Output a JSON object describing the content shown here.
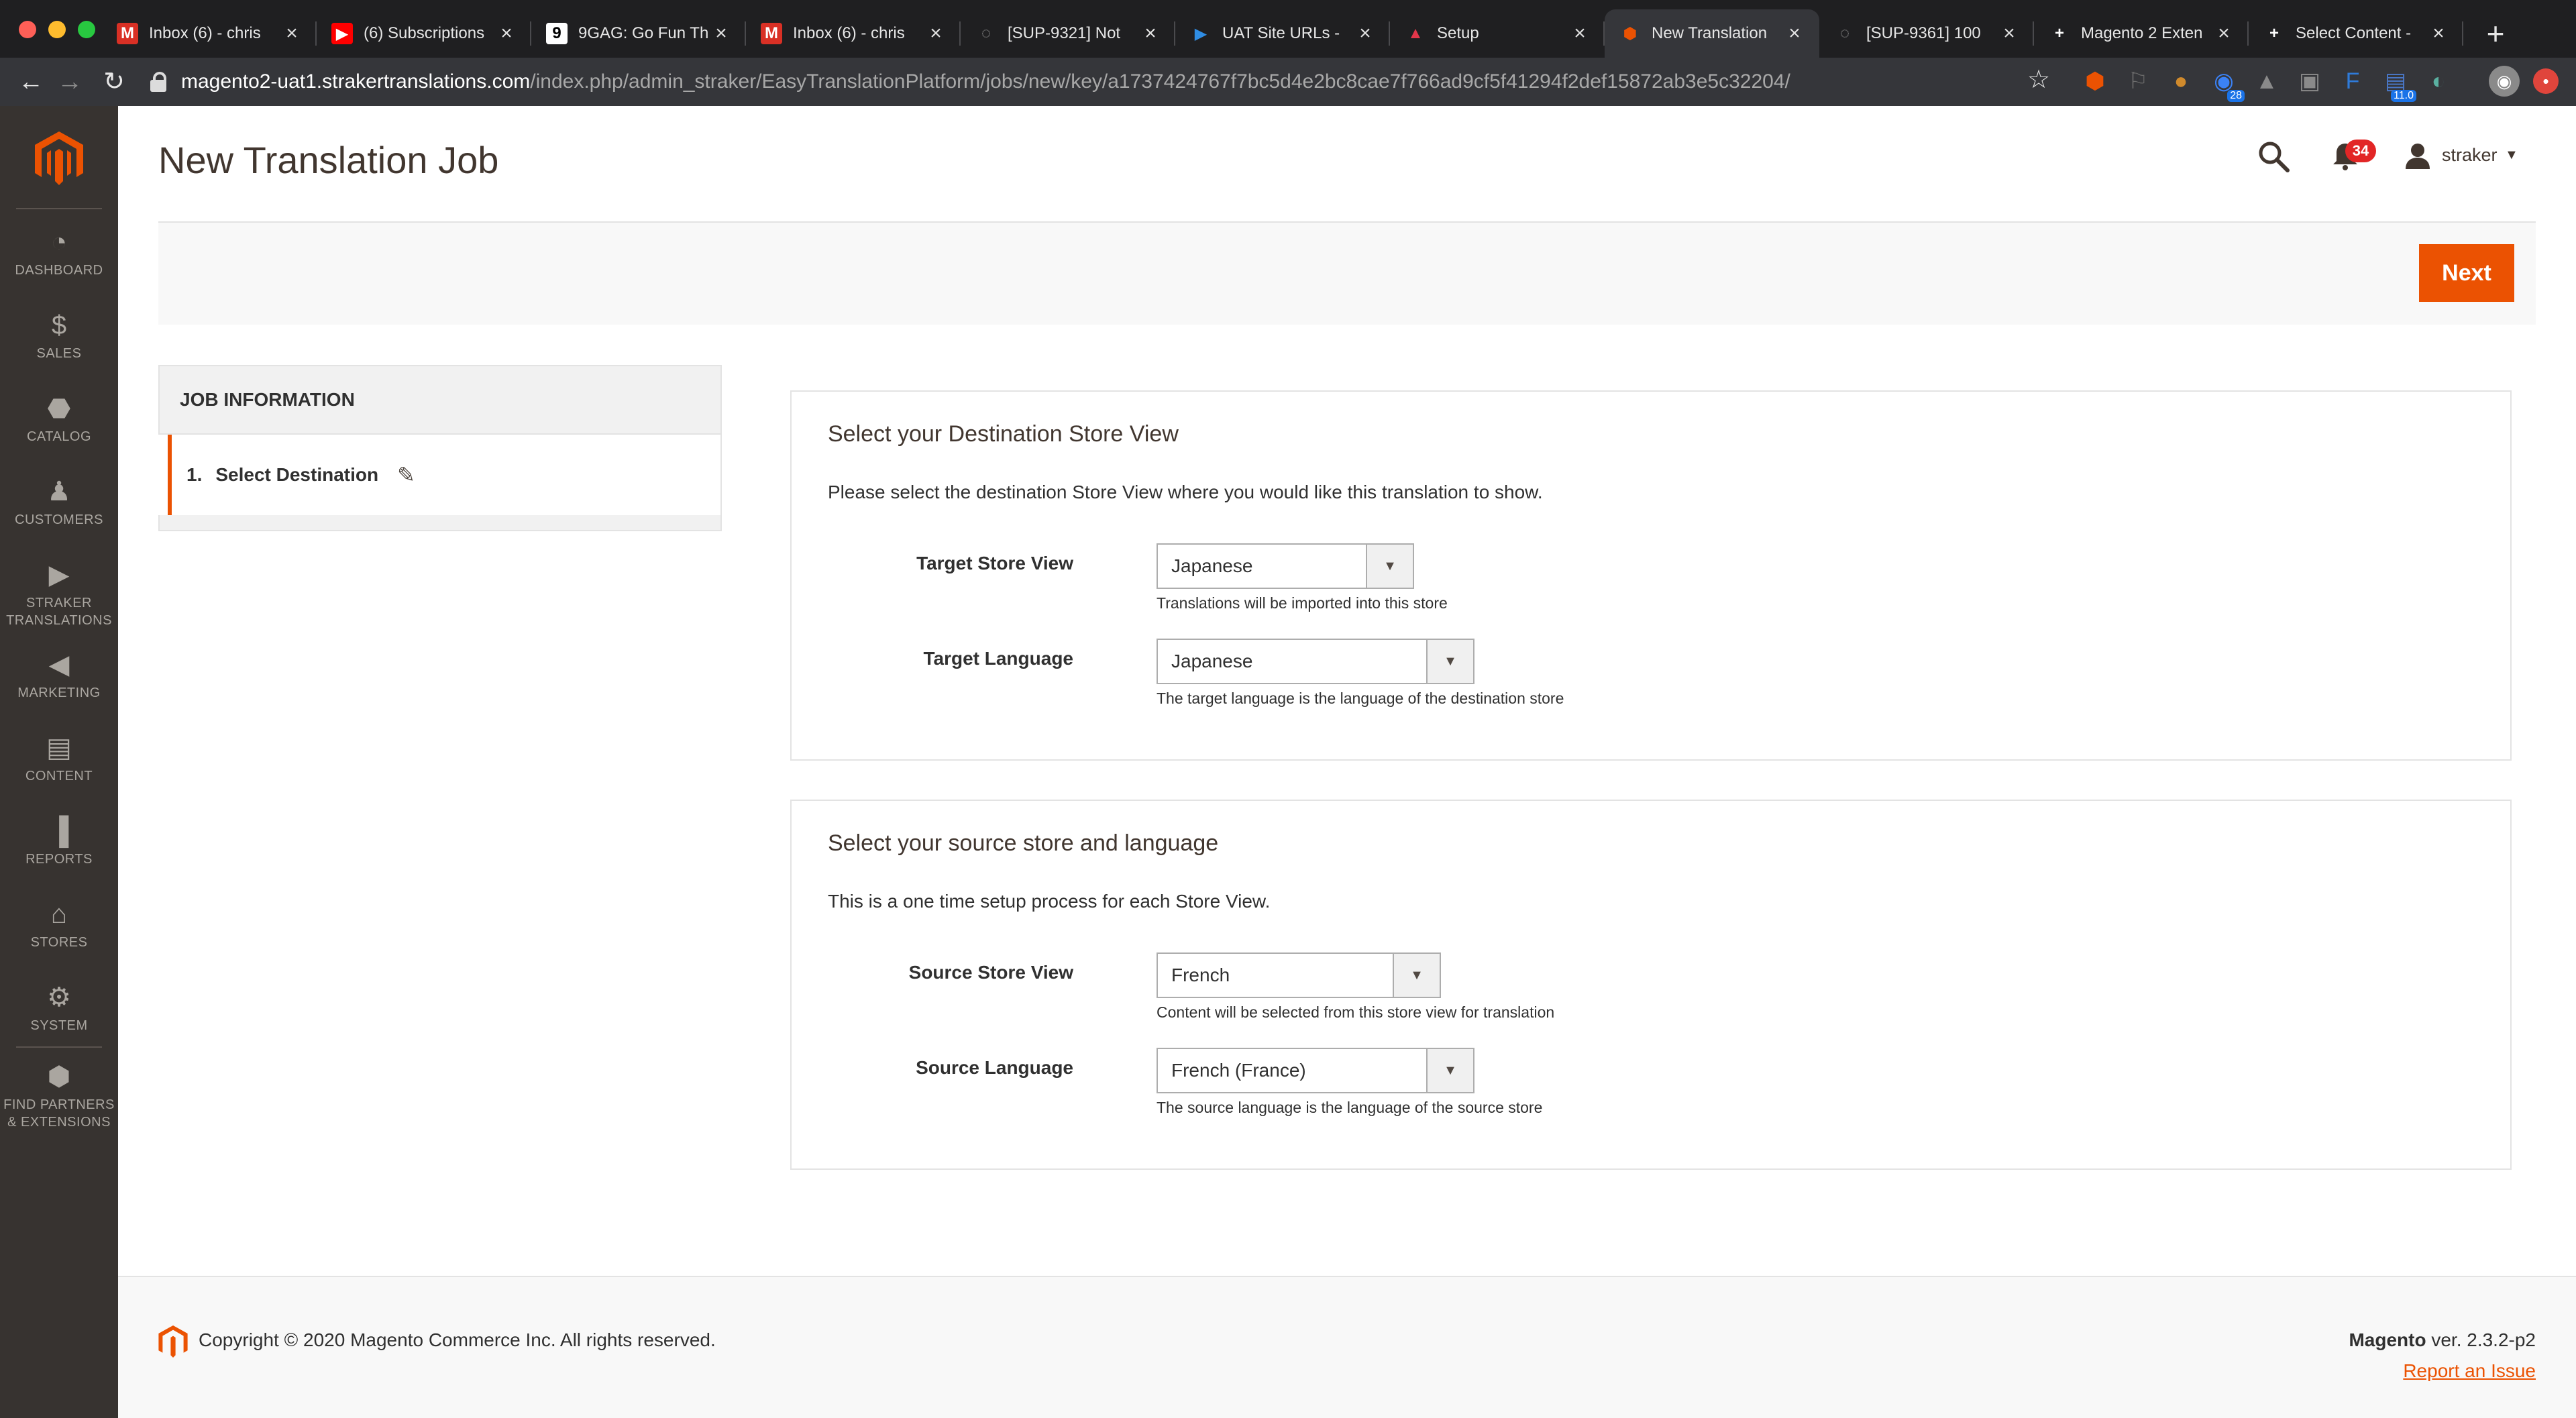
{
  "browser": {
    "tabs": [
      {
        "title": "Inbox (6) - chris",
        "favicon": "gmail-icon",
        "active": false
      },
      {
        "title": "(6) Subscriptions",
        "favicon": "youtube-icon",
        "active": false
      },
      {
        "title": "9GAG: Go Fun Th",
        "favicon": "9gag-icon",
        "active": false
      },
      {
        "title": "Inbox (6) - chris",
        "favicon": "gmail-icon",
        "active": false
      },
      {
        "title": "[SUP-9321] Not",
        "favicon": "globe-icon",
        "active": false
      },
      {
        "title": "UAT Site URLs -",
        "favicon": "play-icon",
        "active": false
      },
      {
        "title": "Setup",
        "favicon": "triangle-icon",
        "active": false
      },
      {
        "title": "New Translation",
        "favicon": "magento-icon",
        "active": true
      },
      {
        "title": "[SUP-9361] 100",
        "favicon": "globe-icon",
        "active": false
      },
      {
        "title": "Magento 2 Exten",
        "favicon": "plus-icon",
        "active": false
      },
      {
        "title": "Select Content -",
        "favicon": "plus-icon",
        "active": false
      }
    ],
    "url_host": "magento2-uat1.strakertranslations.com",
    "url_path": "/index.php/admin_straker/EasyTranslationPlatform/jobs/new/key/a1737424767f7bc5d4e2bc8cae7f766ad9cf5f41294f2def15872ab3e5c32204/",
    "extensions": [
      {
        "name": "magento-ext-icon",
        "color": "#eb5202",
        "badge": ""
      },
      {
        "name": "lightbulb-ext-icon",
        "color": "#6b6b6b",
        "badge": ""
      },
      {
        "name": "cookie-ext-icon",
        "color": "#d08a2c",
        "badge": ""
      },
      {
        "name": "chrome-ext-icon",
        "color": "#3b82f6",
        "badge": "28"
      },
      {
        "name": "mountain-ext-icon",
        "color": "#8a8a8a",
        "badge": ""
      },
      {
        "name": "camera-ext-icon",
        "color": "#8a8a8a",
        "badge": ""
      },
      {
        "name": "f-ext-icon",
        "color": "#2f7bd9",
        "badge": ""
      },
      {
        "name": "bus-ext-icon",
        "color": "#4a78c8",
        "badge": "11.0"
      },
      {
        "name": "circle-ext-icon",
        "color": "#5ab0a0",
        "badge": ""
      }
    ]
  },
  "sidebar": {
    "items": [
      {
        "label": "DASHBOARD",
        "icon": "dashboard-icon"
      },
      {
        "label": "SALES",
        "icon": "dollar-icon"
      },
      {
        "label": "CATALOG",
        "icon": "box-icon"
      },
      {
        "label": "CUSTOMERS",
        "icon": "person-icon"
      },
      {
        "label": "STRAKER TRANSLATIONS",
        "icon": "straker-icon"
      },
      {
        "label": "MARKETING",
        "icon": "megaphone-icon"
      },
      {
        "label": "CONTENT",
        "icon": "content-icon"
      },
      {
        "label": "REPORTS",
        "icon": "bar-chart-icon"
      },
      {
        "label": "STORES",
        "icon": "store-icon"
      },
      {
        "label": "SYSTEM",
        "icon": "gear-icon"
      },
      {
        "label": "FIND PARTNERS & EXTENSIONS",
        "icon": "partners-icon"
      }
    ]
  },
  "header": {
    "title": "New Translation Job",
    "notifications_count": "34",
    "user": "straker"
  },
  "actions": {
    "next_label": "Next"
  },
  "job_nav": {
    "title": "JOB INFORMATION",
    "step_number": "1.",
    "step_label": "Select Destination"
  },
  "destination": {
    "title": "Select your Destination Store View",
    "description": "Please select the destination Store View where you would like this translation to show.",
    "target_store_label": "Target Store View",
    "target_store_value": "Japanese",
    "target_store_note": "Translations will be imported into this store",
    "target_language_label": "Target Language",
    "target_language_value": "Japanese",
    "target_language_note": "The target language is the language of the destination store"
  },
  "source": {
    "title": "Select your source store and language",
    "description": "This is a one time setup process for each Store View.",
    "source_store_label": "Source Store View",
    "source_store_value": "French",
    "source_store_note": "Content will be selected from this store view for translation",
    "source_language_label": "Source Language",
    "source_language_value": "French (France)",
    "source_language_note": "The source language is the language of the source store"
  },
  "footer": {
    "copyright": "Copyright © 2020 Magento Commerce Inc. All rights reserved.",
    "product": "Magento",
    "version": "ver. 2.3.2-p2",
    "report_label": "Report an Issue"
  },
  "colors": {
    "accent": "#eb5202",
    "sidebar_bg": "#373330",
    "badge": "#e22626"
  }
}
